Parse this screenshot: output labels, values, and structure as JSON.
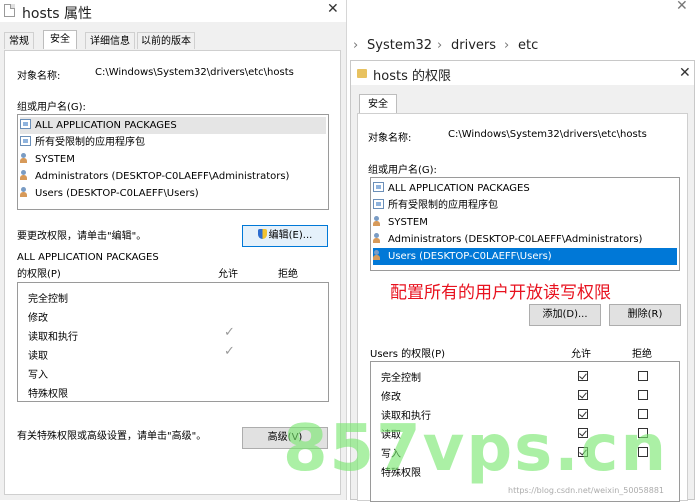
{
  "left": {
    "title": "hosts 属性",
    "tabs": [
      "常规",
      "安全",
      "详细信息",
      "以前的版本"
    ],
    "object_name_label": "对象名称:",
    "object_name_value": "C:\\Windows\\System32\\drivers\\etc\\hosts",
    "group_label": "组或用户名(G):",
    "users": [
      "ALL APPLICATION PACKAGES",
      "所有受限制的应用程序包",
      "SYSTEM",
      "Administrators (DESKTOP-C0LAEFF\\Administrators)",
      "Users (DESKTOP-C0LAEFF\\Users)"
    ],
    "change_hint": "要更改权限，请单击\"编辑\"。",
    "edit_button": "编辑(E)...",
    "perm_for_line1": "ALL APPLICATION PACKAGES",
    "perm_for_line2": "的权限(P)",
    "allow_header": "允许",
    "deny_header": "拒绝",
    "permissions": [
      {
        "name": "完全控制",
        "allow": false
      },
      {
        "name": "修改",
        "allow": false
      },
      {
        "name": "读取和执行",
        "allow": true
      },
      {
        "name": "读取",
        "allow": true
      },
      {
        "name": "写入",
        "allow": false
      },
      {
        "name": "特殊权限",
        "allow": false
      }
    ],
    "advanced_hint": "有关特殊权限或高级设置，请单击\"高级\"。",
    "advanced_button": "高级(V)"
  },
  "right": {
    "breadcrumb": [
      "System32",
      "drivers",
      "etc"
    ],
    "dialog_title": "hosts 的权限",
    "tab": "安全",
    "object_name_label": "对象名称:",
    "object_name_value": "C:\\Windows\\System32\\drivers\\etc\\hosts",
    "group_label": "组或用户名(G):",
    "users": [
      "ALL APPLICATION PACKAGES",
      "所有受限制的应用程序包",
      "SYSTEM",
      "Administrators (DESKTOP-C0LAEFF\\Administrators)",
      "Users (DESKTOP-C0LAEFF\\Users)"
    ],
    "selected_user_index": 4,
    "add_button": "添加(D)...",
    "remove_button": "删除(R)",
    "perm_for": "Users 的权限(P)",
    "allow_header": "允许",
    "deny_header": "拒绝",
    "permissions": [
      {
        "name": "完全控制",
        "allow": true,
        "deny": false
      },
      {
        "name": "修改",
        "allow": true,
        "deny": false
      },
      {
        "name": "读取和执行",
        "allow": true,
        "deny": false
      },
      {
        "name": "读取",
        "allow": true,
        "deny": false
      },
      {
        "name": "写入",
        "allow": true,
        "deny": false
      },
      {
        "name": "特殊权限",
        "allow": false,
        "deny": false
      }
    ]
  },
  "annotation": "配置所有的用户开放读写权限",
  "watermark": "857vps.cn",
  "credit": "https://blog.csdn.net/weixin_50058881",
  "colors": {
    "selection": "#0078d7",
    "annotation": "#e8121f",
    "watermark": "#78e66e"
  }
}
